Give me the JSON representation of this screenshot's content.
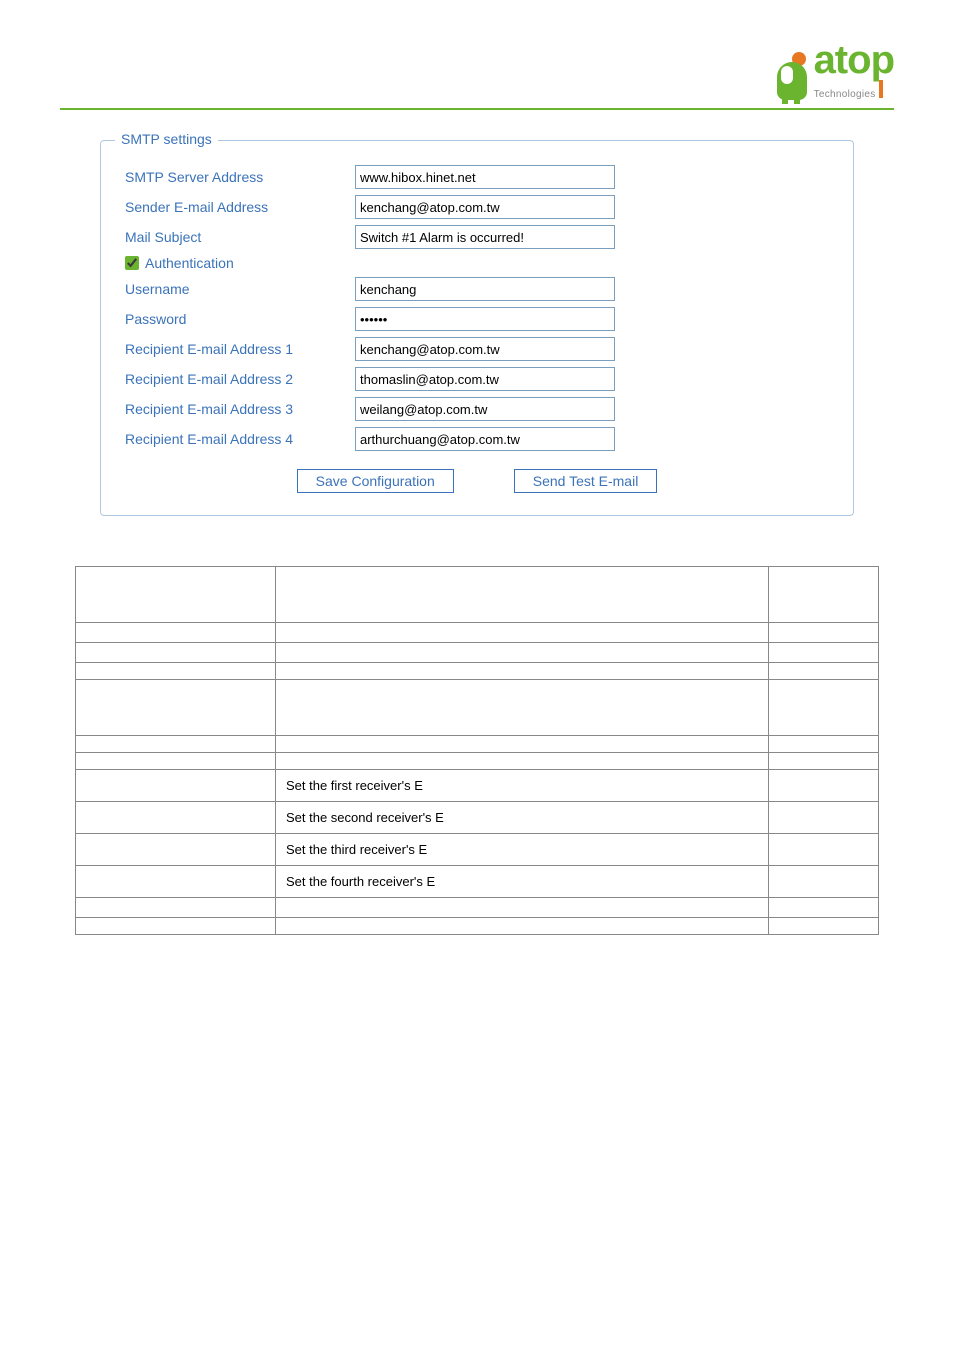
{
  "logo": {
    "word": "atop",
    "sub": "Technologies"
  },
  "fieldset": {
    "legend": "SMTP settings",
    "rows": {
      "smtp_server_label": "SMTP Server Address",
      "smtp_server_value": "www.hibox.hinet.net",
      "sender_label": "Sender E-mail Address",
      "sender_value": "kenchang@atop.com.tw",
      "subject_label": "Mail Subject",
      "subject_value": "Switch #1 Alarm is occurred!",
      "auth_label": "Authentication",
      "username_label": "Username",
      "username_value": "kenchang",
      "password_label": "Password",
      "password_value": "••••••",
      "recip1_label": "Recipient E-mail Address 1",
      "recip1_value": "kenchang@atop.com.tw",
      "recip2_label": "Recipient E-mail Address 2",
      "recip2_value": "thomaslin@atop.com.tw",
      "recip3_label": "Recipient E-mail Address 3",
      "recip3_value": "weilang@atop.com.tw",
      "recip4_label": "Recipient E-mail Address 4",
      "recip4_value": "arthurchuang@atop.com.tw"
    },
    "buttons": {
      "save": "Save Configuration",
      "test": "Send Test E-mail"
    }
  },
  "table": {
    "r1c2": "Set the first receiver's E",
    "r2c2": "Set the second receiver's E",
    "r3c2": "Set the third receiver's E",
    "r4c2": "Set the fourth receiver's E"
  }
}
